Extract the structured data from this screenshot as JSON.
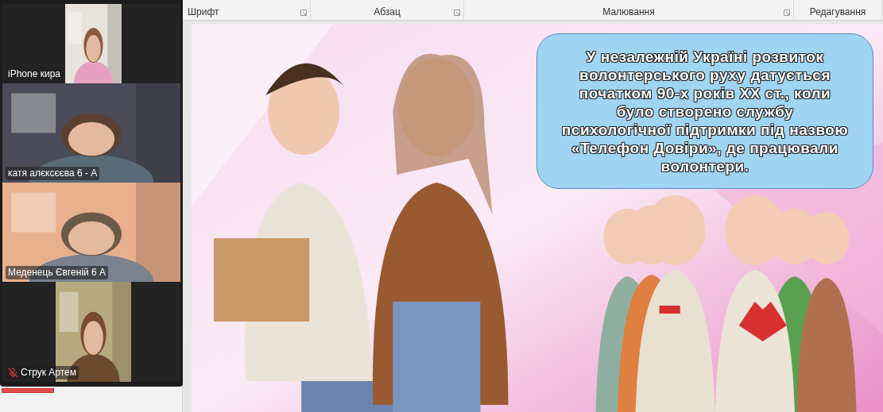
{
  "ribbon": {
    "groups": [
      {
        "label": "Шрифт",
        "launcher": true
      },
      {
        "label": "Абзац",
        "launcher": true
      },
      {
        "label": "Малювання",
        "launcher": true
      },
      {
        "label": "Редагування",
        "launcher": false
      }
    ]
  },
  "participants": [
    {
      "name": "iPhone кира",
      "muted": false
    },
    {
      "name": "катя алєксєєва 6 - А",
      "muted": false
    },
    {
      "name": "Меденець Євгеній 6 А",
      "muted": false
    },
    {
      "name": "Струк Артем",
      "muted": true
    }
  ],
  "slide": {
    "callout": "У незалежній Україні розвиток волонтерського руху датується початком 90-х років XX ст., коли було створено службу психологічної підтримки під назвою «Телефон Довіри», де працювали волонтери."
  }
}
